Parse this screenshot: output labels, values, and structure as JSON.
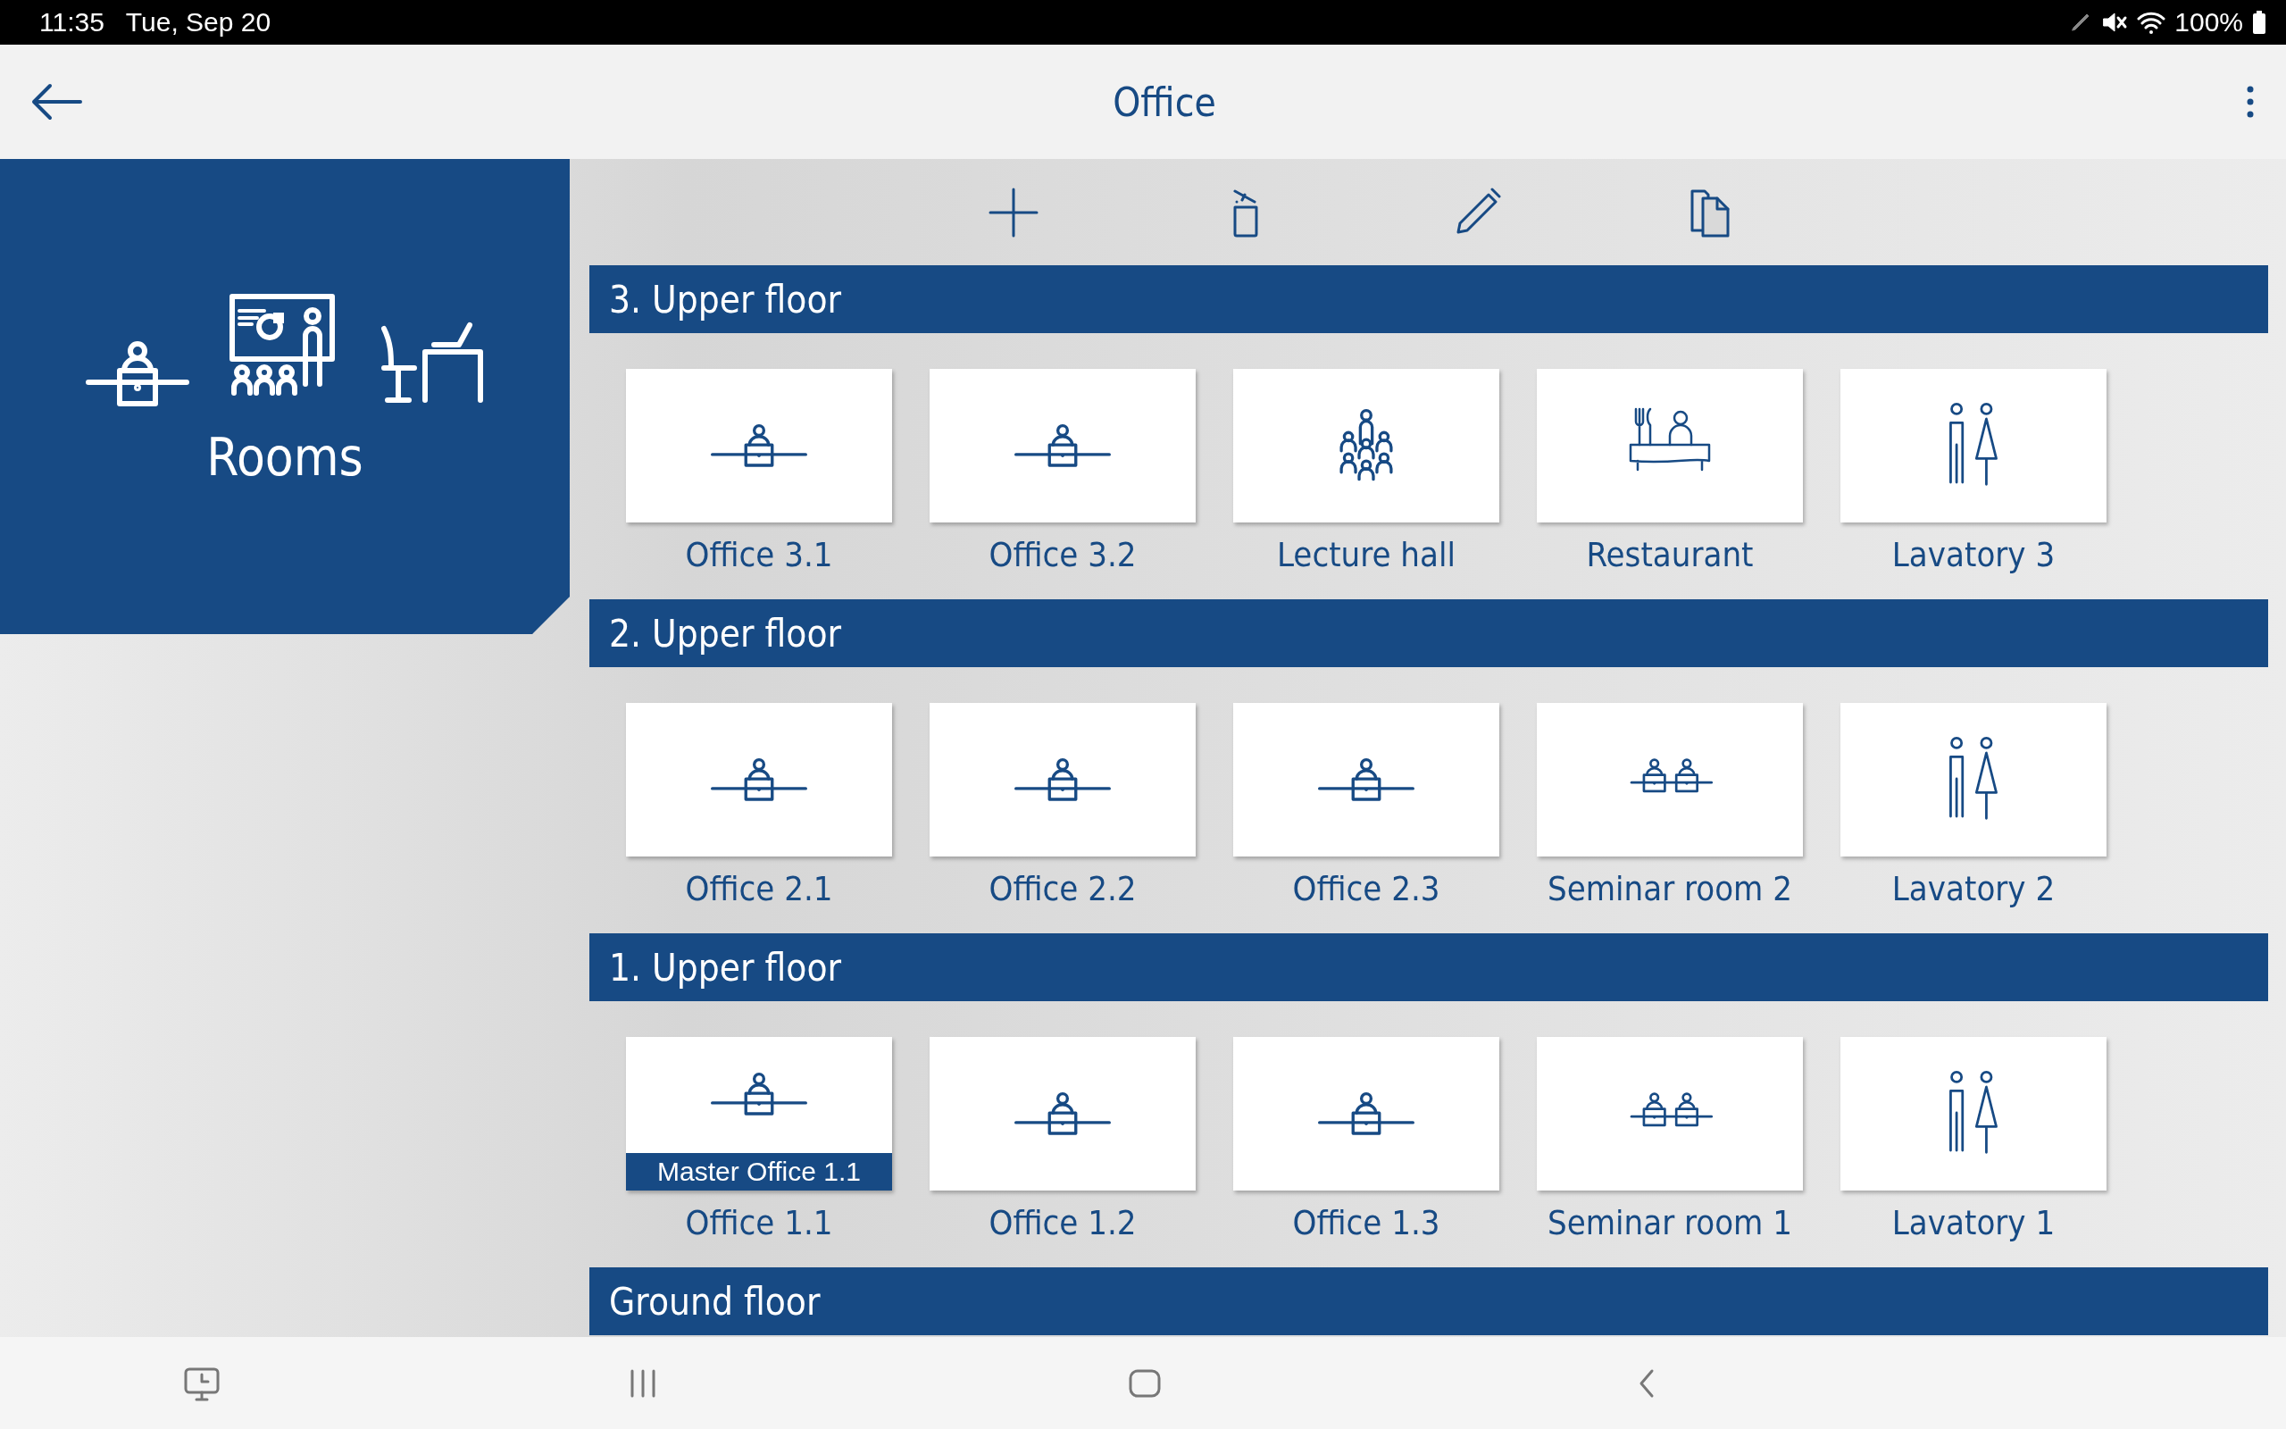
{
  "status_bar": {
    "time": "11:35",
    "date": "Tue, Sep 20",
    "battery": "100%"
  },
  "app_bar": {
    "title": "Office"
  },
  "category": {
    "label": "Rooms"
  },
  "floors": [
    {
      "title": "3. Upper floor",
      "rooms": [
        {
          "name": "Office 3.1",
          "kind": "desk"
        },
        {
          "name": "Office 3.2",
          "kind": "desk"
        },
        {
          "name": "Lecture hall",
          "kind": "lecture"
        },
        {
          "name": "Restaurant",
          "kind": "restaurant"
        },
        {
          "name": "Lavatory 3",
          "kind": "lavatory"
        }
      ]
    },
    {
      "title": "2. Upper floor",
      "rooms": [
        {
          "name": "Office 2.1",
          "kind": "desk"
        },
        {
          "name": "Office 2.2",
          "kind": "desk"
        },
        {
          "name": "Office 2.3",
          "kind": "desk"
        },
        {
          "name": "Seminar room 2",
          "kind": "seminar"
        },
        {
          "name": "Lavatory 2",
          "kind": "lavatory"
        }
      ]
    },
    {
      "title": "1. Upper floor",
      "rooms": [
        {
          "name": "Office 1.1",
          "kind": "desk",
          "badge": "Master Office 1.1"
        },
        {
          "name": "Office 1.2",
          "kind": "desk"
        },
        {
          "name": "Office 1.3",
          "kind": "desk"
        },
        {
          "name": "Seminar room 1",
          "kind": "seminar"
        },
        {
          "name": "Lavatory 1",
          "kind": "lavatory"
        }
      ]
    },
    {
      "title": "Ground floor"
    }
  ]
}
